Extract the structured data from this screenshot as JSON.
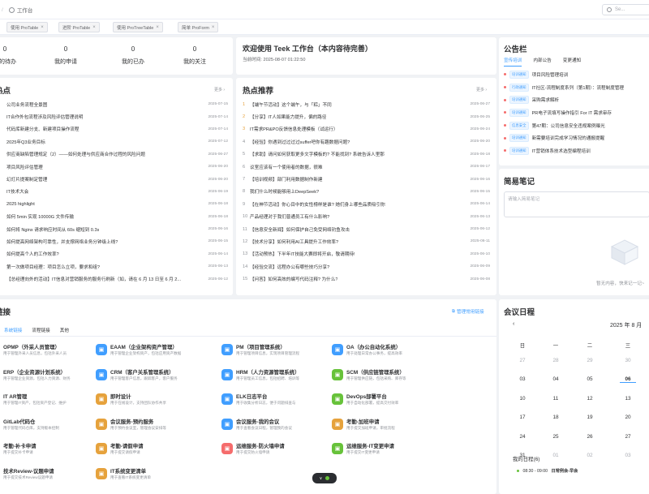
{
  "topbar": {
    "breadcrumb": "工作台",
    "search_placeholder": "Se..."
  },
  "tabs": [
    {
      "label": "使用 ProTable"
    },
    {
      "label": "进阶 ProTable"
    },
    {
      "label": "使用 ProTreeTable"
    },
    {
      "label": "简单 ProForm"
    }
  ],
  "stats": [
    {
      "label": "我的待办",
      "value": "0"
    },
    {
      "label": "我的申请",
      "value": "0"
    },
    {
      "label": "我的已办",
      "value": "0"
    },
    {
      "label": "我的关注",
      "value": "0"
    }
  ],
  "welcome": {
    "title": "欢迎使用 Teek 工作台（本内容待完善）",
    "time_label": "当前时间:",
    "time_value": "2025-08-07 01:22:50"
  },
  "hotspots": {
    "title": "热点",
    "more": "更多",
    "items": [
      {
        "text": "公司业务流程全景图",
        "date": "2025-07-15"
      },
      {
        "text": "IT合作外包流程涉及风险评估管理说明",
        "date": "2025-07-14"
      },
      {
        "text": "代码库新建分支、新建项目操作流程",
        "date": "2025-07-14"
      },
      {
        "text": "2025年Q3业务目标",
        "date": "2025-07-12"
      },
      {
        "text": "供应商缺陷管理规定（2）——如何处理与供应商合作过程的风险问题",
        "date": "2025-06-27"
      },
      {
        "text": "项目风险评估管理",
        "date": "2025-06-20"
      },
      {
        "text": "幻灯片提案制定管理",
        "date": "2025-06-20"
      },
      {
        "text": "IT技术大会",
        "date": "2025-06-19"
      },
      {
        "text": "2025 highlight",
        "date": "2025-06-18"
      },
      {
        "text": "如何 5min 实现 10000G 文件传输",
        "date": "2025-06-18"
      },
      {
        "text": "如何将 Nginx 请求响应时间从 60s 缩短到 0.3s",
        "date": "2025-06-16"
      },
      {
        "text": "如何提高网络架构可靠性，并支撑网络业务分钟级上线?",
        "date": "2025-06-15"
      },
      {
        "text": "如何提高个人的工作效率?",
        "date": "2025-06-14"
      },
      {
        "text": "第一次做项目经理：项目怎么立项，要求和组?",
        "date": "2025-06-13"
      },
      {
        "text": "【总经理向外的活动】IT信息对营销服务的服务行刷新（如，请在 6 月 13 日至 6 月 2...",
        "date": "2025-06-12"
      }
    ]
  },
  "hot_recommend": {
    "title": "热点推荐",
    "more": "更多",
    "items": [
      {
        "idx": "1",
        "text": "【端午节活动】这个端午，与「粽」不同",
        "date": "2025-06-27"
      },
      {
        "idx": "2",
        "text": "【分享】IT人如果能力提升，偏的路径",
        "date": "2025-06-25"
      },
      {
        "idx": "3",
        "text": "IT需求PR&PO反馈信息处理模板（试运行）",
        "date": "2025-06-24"
      },
      {
        "idx": "4",
        "text": "【经验】你遇到过过过过suffer吧你有趣数据问题?",
        "date": "2025-06-20"
      },
      {
        "idx": "5",
        "text": "【求助】请问如何获取更多文字模板的? 不能找到? 系统告诉人里那",
        "date": "2025-06-18"
      },
      {
        "idx": "6",
        "text": "议室应该有一个使用者的数据，很难",
        "date": "2025-06-17"
      },
      {
        "idx": "7",
        "text": "【培训视频】部门利用数据制作新建",
        "date": "2025-06-16"
      },
      {
        "idx": "8",
        "text": "我们什么时候能够用上DeepSeek?",
        "date": "2025-06-15"
      },
      {
        "idx": "9",
        "text": "【在神节活动】你心目中的女性榜样是谁? 她们身上哪些品质吸引你",
        "date": "2025-06-14"
      },
      {
        "idx": "10",
        "text": "产品经理对于我们普通员工有什么影响?",
        "date": "2025-06-13"
      },
      {
        "idx": "11",
        "text": "【信息安全新闻】如何保护自己免受网络钓鱼攻击",
        "date": "2025-06-12"
      },
      {
        "idx": "12",
        "text": "【技术分享】如何利用AI工具提升工作效率?",
        "date": "2025-06-11"
      },
      {
        "idx": "13",
        "text": "【活动预热】下半年IT技能大赛即将开启，敬请期待!",
        "date": "2025-06-10"
      },
      {
        "idx": "14",
        "text": "【经验交流】远程办公有哪些技巧分享?",
        "date": "2025-06-09"
      },
      {
        "idx": "15",
        "text": "【问答】如何高效的编写代码注释? 为什么?",
        "date": "2025-06-08"
      }
    ]
  },
  "notice": {
    "title": "公告栏",
    "tabs": [
      "宣传培训",
      "内部公告",
      "变更通知"
    ],
    "items": [
      {
        "badge": "培训通知",
        "text": "项目风险管理培训"
      },
      {
        "badge": "行政通知",
        "text": "IT社区-流程制度系列（第1期）：流程制度管理"
      },
      {
        "badge": "培训通知",
        "text": "采购需求解析"
      },
      {
        "badge": "培训通知",
        "text": "PR电子流填写操作指引 For IT 需求审存"
      },
      {
        "badge": "信息安全",
        "text": "第47期：公司信息安全违规案例曝光"
      },
      {
        "badge": "培训通知",
        "text": "新需要培训完成学习情况的通报提醒"
      },
      {
        "badge": "培训通知",
        "text": "IT营销体系技术选型编程培训"
      }
    ]
  },
  "memo": {
    "title": "简易笔记",
    "placeholder": "请输入简易笔记",
    "empty_text": "暂无内容，快来记一记~"
  },
  "links": {
    "title": "链接",
    "manage": "管理常用链接",
    "tabs": [
      "系统链接",
      "流程链接",
      "其他"
    ],
    "items": [
      {
        "title": "OPMP（外采人员管理）",
        "desc": "用于管理外采人员信息，包括外采人员",
        "color": "#409eff"
      },
      {
        "title": "EAAM（企业架构资产管理）",
        "desc": "用于管理企业架构资产，包括应用资产数据",
        "color": "#409eff"
      },
      {
        "title": "PM（项目管理系统）",
        "desc": "用于管理项目信息，实现项目管理流程",
        "color": "#409eff"
      },
      {
        "title": "OA（办公自动化系统）",
        "desc": "用于处理日常办公事务，提高效率",
        "color": "#409eff"
      },
      {
        "title": "ERP（企业资源计划系统）",
        "desc": "用于管理企业资源，包括人力资源、财务",
        "color": "#409eff"
      },
      {
        "title": "CRM（客户关系管理系统）",
        "desc": "用于管理客户信息，跟踪客户，客户服务",
        "color": "#409eff"
      },
      {
        "title": "HRM（人力资源管理系统）",
        "desc": "用于管理员工信息，包括招聘、培训等",
        "color": "#409eff"
      },
      {
        "title": "SCM（供应链管理系统）",
        "desc": "用于管理供应链，包括采购、库存等",
        "color": "#67c23a"
      },
      {
        "title": "IT AR管理",
        "desc": "用于管理IT资产，包括资产登记、维护",
        "color": "#409eff"
      },
      {
        "title": "即时设计",
        "desc": "用于在线设计，支持团队协作共享",
        "color": "#e6a23c"
      },
      {
        "title": "ELK日志平台",
        "desc": "用于收集分析日志，便于问题排查与",
        "color": "#409eff"
      },
      {
        "title": "DevOps部署平台",
        "desc": "用于自动化部署，提高交付效率",
        "color": "#67c23a"
      },
      {
        "title": "GitLab代码仓",
        "desc": "用于管理代码仓库，支持版本控制",
        "color": "#409eff"
      },
      {
        "title": "会议服务-预约服务",
        "desc": "用于预约会议室，管理会议安排等",
        "color": "#e6a23c"
      },
      {
        "title": "会议服务-我的会议",
        "desc": "用于查看会议日程，管理我的会议",
        "color": "#409eff"
      },
      {
        "title": "考勤-加班申请",
        "desc": "用于提交加班申请，审批流程",
        "color": "#e6a23c"
      },
      {
        "title": "考勤-补卡申请",
        "desc": "用于提交补卡申请",
        "color": "#409eff"
      },
      {
        "title": "考勤-请假申请",
        "desc": "用于提交请假申请",
        "color": "#e6a23c"
      },
      {
        "title": "运维服务-防火墙申请",
        "desc": "用于提交防火墙申请",
        "color": "#f56c6c"
      },
      {
        "title": "运维服务-IT变更申请",
        "desc": "用于提交IT变更申请",
        "color": "#67c23a"
      },
      {
        "title": "技术Review-议题申请",
        "desc": "用于提交技术Review议题申请",
        "color": "#409eff"
      },
      {
        "title": "IT系统变更清单",
        "desc": "用于查看IT系统变更清单",
        "color": "#e6a23c"
      }
    ]
  },
  "calendar": {
    "title": "会议日程",
    "month": "2025 年 8 月",
    "weekdays": [
      "日",
      "一",
      "二",
      "三"
    ],
    "rows": [
      [
        "27",
        "28",
        "29",
        "30"
      ],
      [
        "03",
        "04",
        "05",
        "06"
      ],
      [
        "10",
        "11",
        "12",
        "13"
      ],
      [
        "17",
        "18",
        "19",
        "20"
      ],
      [
        "24",
        "25",
        "26",
        "27"
      ],
      [
        "31",
        "01",
        "02",
        "03"
      ]
    ],
    "today": "06",
    "schedule_title": "我的日程",
    "schedule_count": "(6)",
    "schedule_item_time": "08:30 - 09:00",
    "schedule_item_text": "日常例会-早会"
  },
  "colors": {
    "accent": "#409eff",
    "warning": "#e6a23c",
    "danger": "#f56c6c",
    "success": "#67c23a"
  }
}
